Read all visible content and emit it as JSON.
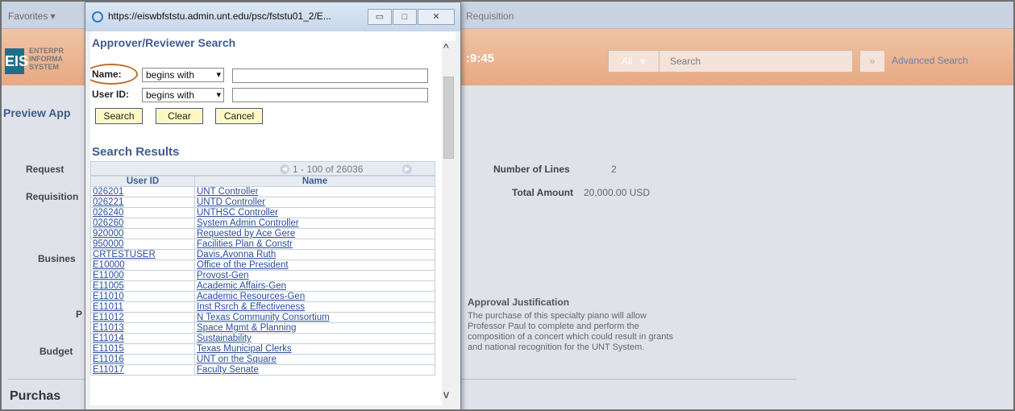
{
  "background": {
    "favorites_label": "Favorites ▾",
    "breadcrumb": "Requisition",
    "logo_text": "EIS",
    "logo_words": [
      "ENTERPR",
      "INFORMA",
      "SYSTEM"
    ],
    "time_fragment": ":9:45",
    "search_scope": "All",
    "search_placeholder": "Search",
    "advanced_search": "Advanced Search",
    "preview_title": "Preview App",
    "labels": {
      "requester": "Request",
      "requisition": "Requisition",
      "business": "Busines",
      "p": "P",
      "budget": "Budget"
    },
    "number_of_lines_label": "Number of Lines",
    "number_of_lines_value": "2",
    "total_amount_label": "Total Amount",
    "total_amount_value": "20,000.00 USD",
    "approval_justification_title": "Approval Justification",
    "approval_justification_lines": [
      "The purchase of this specialty piano will allow",
      "Professor Paul to complete and perform the",
      "composition of a concert which could result in grants",
      "and national recognition for the UNT System."
    ],
    "purchase_heading": "Purchas"
  },
  "popup": {
    "url": "https://eiswbfststu.admin.unt.edu/psc/fststu01_2/E...",
    "title": "Approver/Reviewer Search",
    "name_label": "Name:",
    "userid_label": "User ID:",
    "operator_value": "begins with",
    "name_value": "",
    "userid_value": "",
    "buttons": {
      "search": "Search",
      "clear": "Clear",
      "cancel": "Cancel"
    },
    "results_title": "Search Results",
    "pagination": "1 - 100 of 26036",
    "columns": [
      "User ID",
      "Name"
    ],
    "rows": [
      [
        "026201",
        "UNT Controller"
      ],
      [
        "026221",
        "UNTD Controller"
      ],
      [
        "026240",
        "UNTHSC Controller"
      ],
      [
        "026260",
        "System Admin Controller"
      ],
      [
        "920000",
        "Requested by Ace Gere"
      ],
      [
        "950000",
        "Facilities Plan & Constr"
      ],
      [
        "CRTESTUSER",
        "Davis,Avonna Ruth"
      ],
      [
        "E10000",
        "Office of the President"
      ],
      [
        "E11000",
        "Provost-Gen"
      ],
      [
        "E11005",
        "Academic Affairs-Gen"
      ],
      [
        "E11010",
        "Academic Resources-Gen"
      ],
      [
        "E11011",
        "Inst Rsrch & Effectiveness"
      ],
      [
        "E11012",
        "N Texas Community Consortium"
      ],
      [
        "E11013",
        "Space Mgmt & Planning"
      ],
      [
        "E11014",
        "Sustainability"
      ],
      [
        "E11015",
        "Texas Municipal Clerks"
      ],
      [
        "E11016",
        "UNT on the Square"
      ],
      [
        "E11017",
        "Faculty Senate"
      ]
    ]
  },
  "colors": {
    "heading_blue": "#3d5d8f",
    "link_blue": "#2a4f98",
    "button_yellow": "#fdf7c4",
    "highlight_orange": "#c0702d",
    "header_orange": "#e7a984"
  }
}
